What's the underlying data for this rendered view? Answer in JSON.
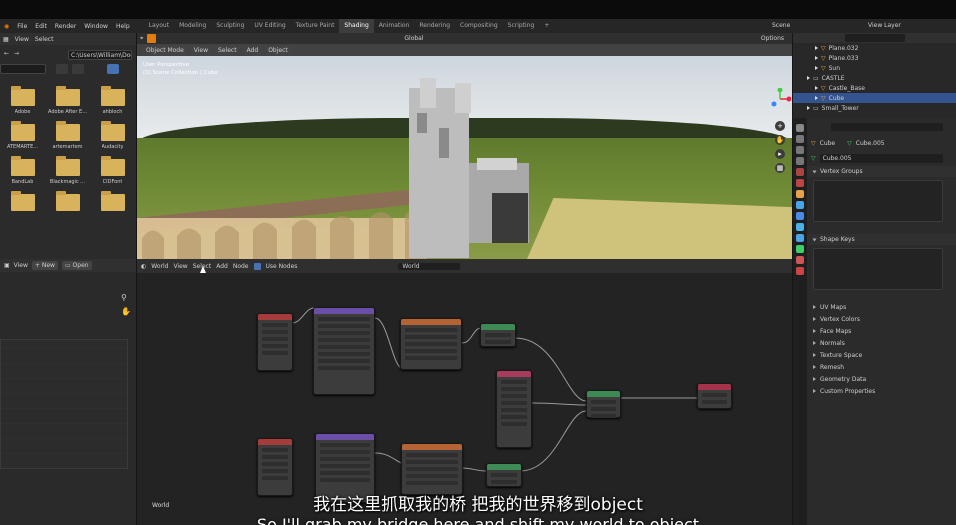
{
  "menu": {
    "items": [
      "File",
      "Edit",
      "Render",
      "Window",
      "Help"
    ],
    "workspaces": [
      "Layout",
      "Modeling",
      "Sculpting",
      "UV Editing",
      "Texture Paint",
      "Shading",
      "Animation",
      "Rendering",
      "Compositing",
      "Scripting",
      "+"
    ],
    "active_workspace": "Shading",
    "scene": "Scene",
    "view_layer": "View Layer"
  },
  "file_browser": {
    "header_view": "View",
    "header_select": "Select",
    "path": "C:\\Users\\William\\Doc...",
    "search_value": "",
    "folders": [
      "",
      "",
      "",
      "Adobe",
      "Adobe After E...",
      "ahbloch",
      "ATEMARTE...",
      "artemartem",
      "Audacity",
      "BandLab",
      "Blackmagic ...",
      "CIDFont",
      "",
      "",
      ""
    ]
  },
  "image_view": {
    "view": "View",
    "new_label": "New",
    "open_label": "Open"
  },
  "viewport": {
    "mode": "Object Mode",
    "menus": [
      "View",
      "Select",
      "Add",
      "Object"
    ],
    "orientation": "Global",
    "options": "Options",
    "info_line1": "User Perspective",
    "info_line2": "(1) Scene Collection | Cube"
  },
  "node_editor": {
    "type": "World",
    "menus": [
      "View",
      "Select",
      "Add",
      "Node"
    ],
    "use_nodes": "Use Nodes",
    "world_field": "World",
    "footer_label": "World"
  },
  "outliner": {
    "rows": [
      {
        "label": "Plane.032",
        "indent": 1,
        "selected": false
      },
      {
        "label": "Plane.033",
        "indent": 1,
        "selected": false
      },
      {
        "label": "Sun",
        "indent": 1,
        "selected": false
      },
      {
        "label": "CASTLE",
        "indent": 0,
        "selected": false
      },
      {
        "label": "Castle_Base",
        "indent": 1,
        "selected": false
      },
      {
        "label": "Cube",
        "indent": 1,
        "selected": true
      },
      {
        "label": "Small_Tower",
        "indent": 0,
        "selected": false
      }
    ]
  },
  "properties": {
    "object_name": "Cube",
    "mesh_name": "Cube.005",
    "mesh_field": "Cube.005",
    "sections_open": [
      "Vertex Groups",
      "Shape Keys"
    ],
    "sections_closed": [
      "UV Maps",
      "Vertex Colors",
      "Face Maps",
      "Normals",
      "Texture Space",
      "Remesh",
      "Geometry Data",
      "Custom Properties"
    ]
  },
  "subtitles": {
    "zh": "我在这里抓取我的桥 把我的世界移到object",
    "en": "So I'll grab my bridge here and shift my world to object"
  },
  "colors": {
    "accent_blue": "#33548f",
    "active_tab": "#3d3d3d",
    "folder": "#d9b25c"
  }
}
